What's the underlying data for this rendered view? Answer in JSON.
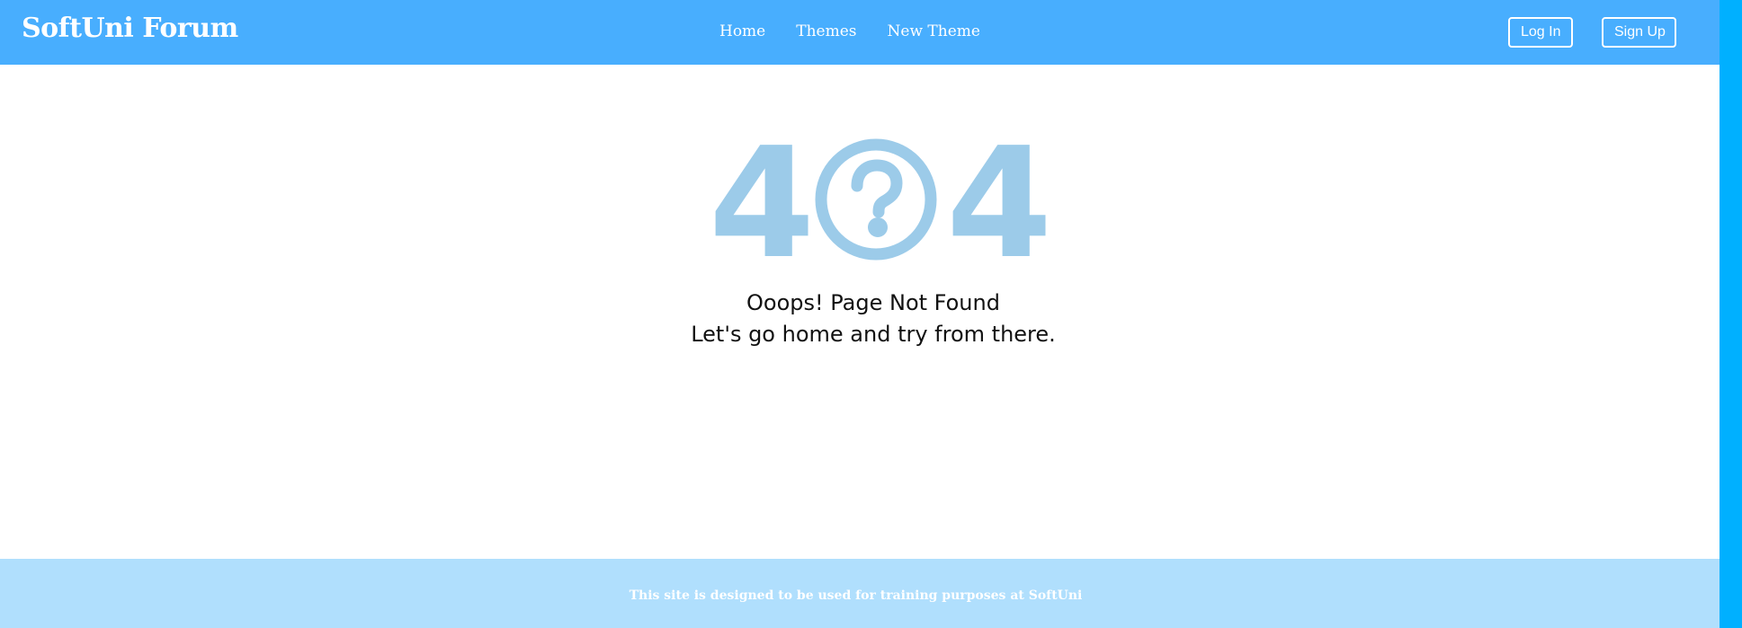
{
  "header": {
    "brand": "SoftUni Forum",
    "nav": [
      {
        "label": "Home"
      },
      {
        "label": "Themes"
      },
      {
        "label": "New Theme"
      }
    ],
    "login_label": "Log In",
    "signup_label": "Sign Up"
  },
  "error": {
    "digit_left": "4",
    "digit_right": "4",
    "middle_icon": "question-circle-icon",
    "title": "Ooops! Page Not Found",
    "message": "Let's go home and try from there."
  },
  "footer": {
    "text": "This site is designed to be used for training purposes at SoftUni"
  },
  "colors": {
    "navbar": "#48aefe",
    "footer": "#b0dffd",
    "error_graphic": "#9ccbe9",
    "right_strip": "#00b0ff"
  }
}
